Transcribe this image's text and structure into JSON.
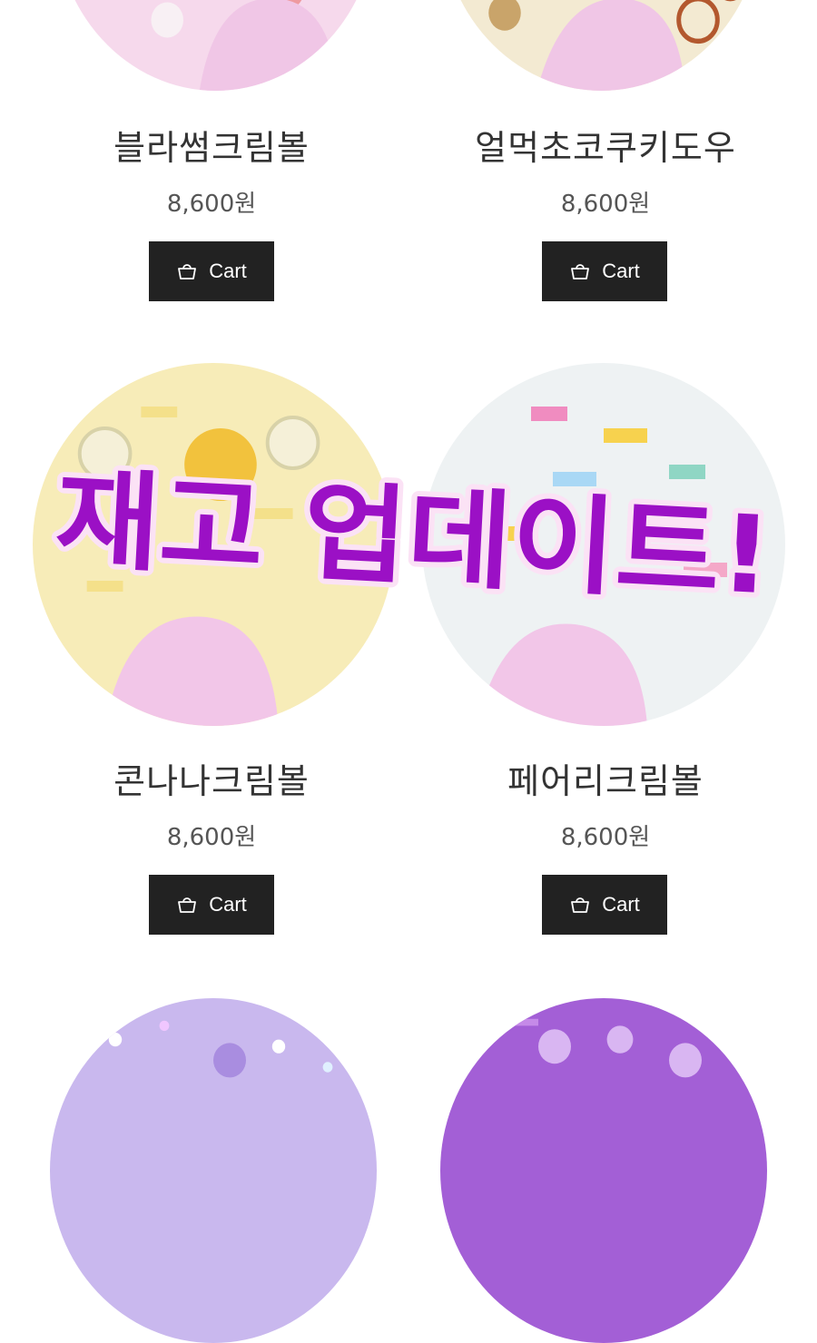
{
  "products": [
    {
      "name": "블라썸크림볼",
      "price": "8,600원",
      "cart_label": "Cart",
      "ball_color": "#f6d9ec",
      "accent": "#e8b9e0"
    },
    {
      "name": "얼먹초코쿠키도우",
      "price": "8,600원",
      "cart_label": "Cart",
      "ball_color": "#f3ead2",
      "accent": "#c9a46a"
    },
    {
      "name": "콘나나크림볼",
      "price": "8,600원",
      "cart_label": "Cart",
      "ball_color": "#f7ecb8",
      "accent": "#f2c23d"
    },
    {
      "name": "페어리크림볼",
      "price": "8,600원",
      "cart_label": "Cart",
      "ball_color": "#eef2f3",
      "accent": "#f08cc0"
    },
    {
      "ball_color": "#c9b8ee",
      "accent": "#a98de0"
    },
    {
      "ball_color": "#a35fd6",
      "accent": "#d9b6f2"
    }
  ],
  "overlay": {
    "text": "재고 업데이트!",
    "fill": "#9b10c5",
    "stroke": "#fbe2f5"
  },
  "icons": {
    "cart": "shopping-basket-icon"
  }
}
